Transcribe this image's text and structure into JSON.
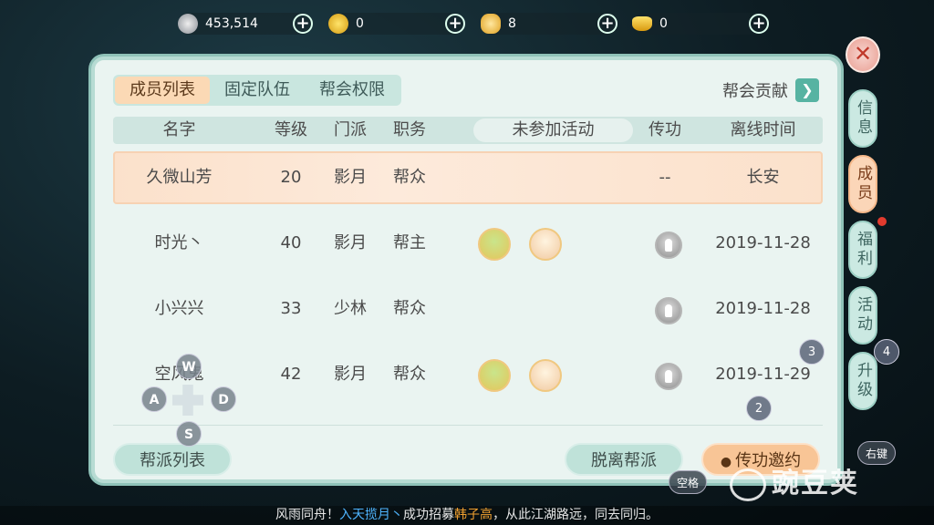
{
  "currencies": [
    {
      "name": "silver-coin-icon",
      "value": "453,514"
    },
    {
      "name": "gold-coin-icon",
      "value": "0"
    },
    {
      "name": "ingot-coin-icon",
      "value": "8"
    },
    {
      "name": "gold-ingot-icon",
      "value": "0"
    }
  ],
  "tabs": [
    "成员列表",
    "固定队伍",
    "帮会权限"
  ],
  "contrib_label": "帮会贡献",
  "headers": {
    "name": "名字",
    "level": "等级",
    "sect": "门派",
    "duty": "职务",
    "activity": "未参加活动",
    "pass": "传功",
    "offline": "离线时间"
  },
  "members": [
    {
      "name": "久微山芳",
      "level": "20",
      "sect": "影月",
      "duty": "帮众",
      "pass": "--",
      "offline": "长安",
      "activities": false,
      "pass_icon": false
    },
    {
      "name": "时光丶",
      "level": "40",
      "sect": "影月",
      "duty": "帮主",
      "pass": "",
      "offline": "2019-11-28",
      "activities": true,
      "pass_icon": true
    },
    {
      "name": "小兴兴",
      "level": "33",
      "sect": "少林",
      "duty": "帮众",
      "pass": "",
      "offline": "2019-11-28",
      "activities": false,
      "pass_icon": true
    },
    {
      "name": "空风鬼",
      "level": "42",
      "sect": "影月",
      "duty": "帮众",
      "pass": "",
      "offline": "2019-11-29",
      "activities": true,
      "pass_icon": true
    }
  ],
  "buttons": {
    "list": "帮派列表",
    "leave": "脱离帮派",
    "invite": "传功邀约"
  },
  "side_tabs": [
    "信息",
    "成员",
    "福利",
    "活动",
    "升级"
  ],
  "keys": {
    "w": "W",
    "a": "A",
    "s": "S",
    "d": "D"
  },
  "badges": {
    "b2": "2",
    "b3": "3",
    "b4": "4",
    "space": "空格",
    "right": "右键"
  },
  "ticker": {
    "p1": "风雨同舟！",
    "p2": "入天揽月丶",
    "p3": "成功招募",
    "p4": "韩子高",
    "p5": "，从此江湖路远，同去同归。"
  },
  "watermark": "豌豆荚",
  "colors": {
    "accent": "#57b3a2",
    "selected_row": "#fbe1cb",
    "invite_button": "#f8c596"
  }
}
